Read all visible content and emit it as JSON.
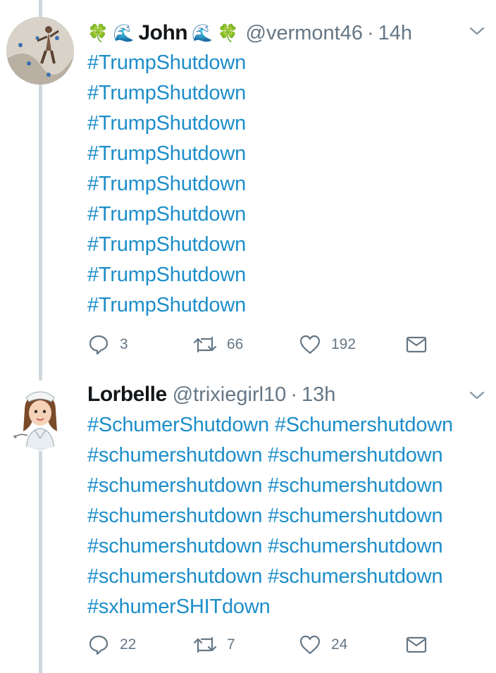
{
  "tweets": [
    {
      "name": "John",
      "name_emoji_before": "🍀 🌊",
      "name_emoji_after": "🌊 🍀",
      "handle": "@vermont46",
      "separator": "·",
      "time": "14h",
      "lines": [
        "#TrumpShutdown",
        "#TrumpShutdown",
        "#TrumpShutdown",
        "#TrumpShutdown",
        "#TrumpShutdown",
        "#TrumpShutdown",
        "#TrumpShutdown",
        "#TrumpShutdown",
        "#TrumpShutdown"
      ],
      "replies": "3",
      "retweets": "66",
      "likes": "192"
    },
    {
      "name": "Lorbelle",
      "handle": "@trixiegirl10",
      "separator": "·",
      "time": "13h",
      "lines": [
        "#SchumerShutdown #Schumershutdown",
        "#schumershutdown #schumershutdown",
        "#schumershutdown #schumershutdown",
        "#schumershutdown #schumershutdown",
        "#schumershutdown #schumershutdown",
        "#schumershutdown #schumershutdown",
        "#sxhumerSHITdown"
      ],
      "replies": "22",
      "retweets": "7",
      "likes": "24"
    }
  ],
  "colors": {
    "link": "#1d8ec9",
    "muted": "#657786",
    "thread_line": "#cfd9de"
  },
  "icons": [
    "reply-icon",
    "retweet-icon",
    "like-icon",
    "direct-message-icon",
    "chevron-down-icon"
  ]
}
